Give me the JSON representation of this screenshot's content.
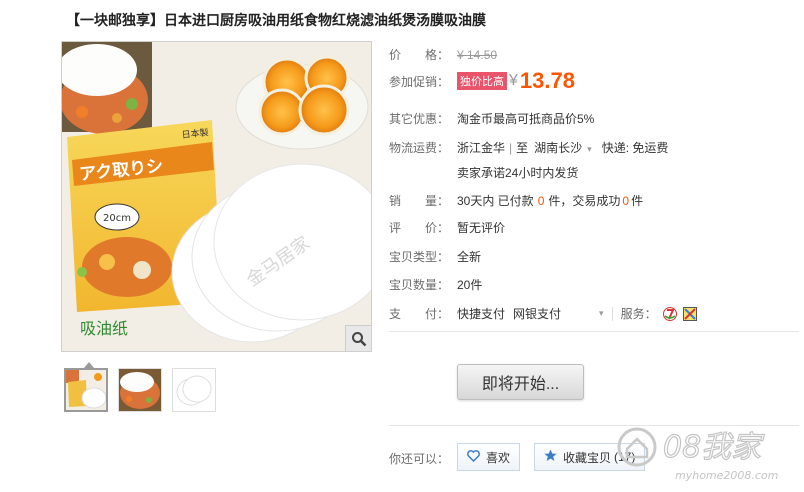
{
  "title": "【一块邮独享】日本进口厨房吸油用纸食物红烧滤油纸煲汤膜吸油膜",
  "image": {
    "caption": "吸油纸",
    "package_text_1": "アク取りシ",
    "package_text_2": "日本製",
    "package_text_3": "20cm",
    "watermark": "金马居家"
  },
  "details": {
    "price_label": "价　　格：",
    "price_original": "¥ 14.50",
    "promo_label": "参加促销：",
    "promo_badge": "独价比高",
    "promo_currency": "¥",
    "promo_price": "13.78",
    "other_label": "其它优惠：",
    "other_value": "淘金币最高可抵商品价5%",
    "shipping_label": "物流运费：",
    "shipping_from": "浙江金华",
    "shipping_sep": "|",
    "shipping_to_prefix": "至",
    "shipping_to": "湖南长沙",
    "shipping_fee": "快递: 免运费",
    "shipping_promise": "卖家承诺24小时内发货",
    "sales_label": "销　　量：",
    "sales_prefix": "30天内 已付款",
    "sales_paid": "0",
    "sales_mid": "件，交易成功",
    "sales_done": "0",
    "sales_suffix": "件",
    "rating_label": "评　　价：",
    "rating_value": "暂无评价",
    "type_label": "宝贝类型：",
    "type_value": "全新",
    "qty_label": "宝贝数量：",
    "qty_value": "20件",
    "pay_label": "支　　付：",
    "pay_1": "快捷支付",
    "pay_2": "网银支付",
    "service_label": "服务："
  },
  "buy_button": "即将开始...",
  "you_can_label": "你还可以：",
  "like_button": "喜欢",
  "fav_button": "收藏宝贝",
  "fav_count": "(17)",
  "site_logo": {
    "text": "08我家",
    "url": "myhome2008.com"
  },
  "colors": {
    "price_orange": "#ff5500",
    "badge_red": "#e9546b",
    "link_blue": "#3a7ec8"
  }
}
